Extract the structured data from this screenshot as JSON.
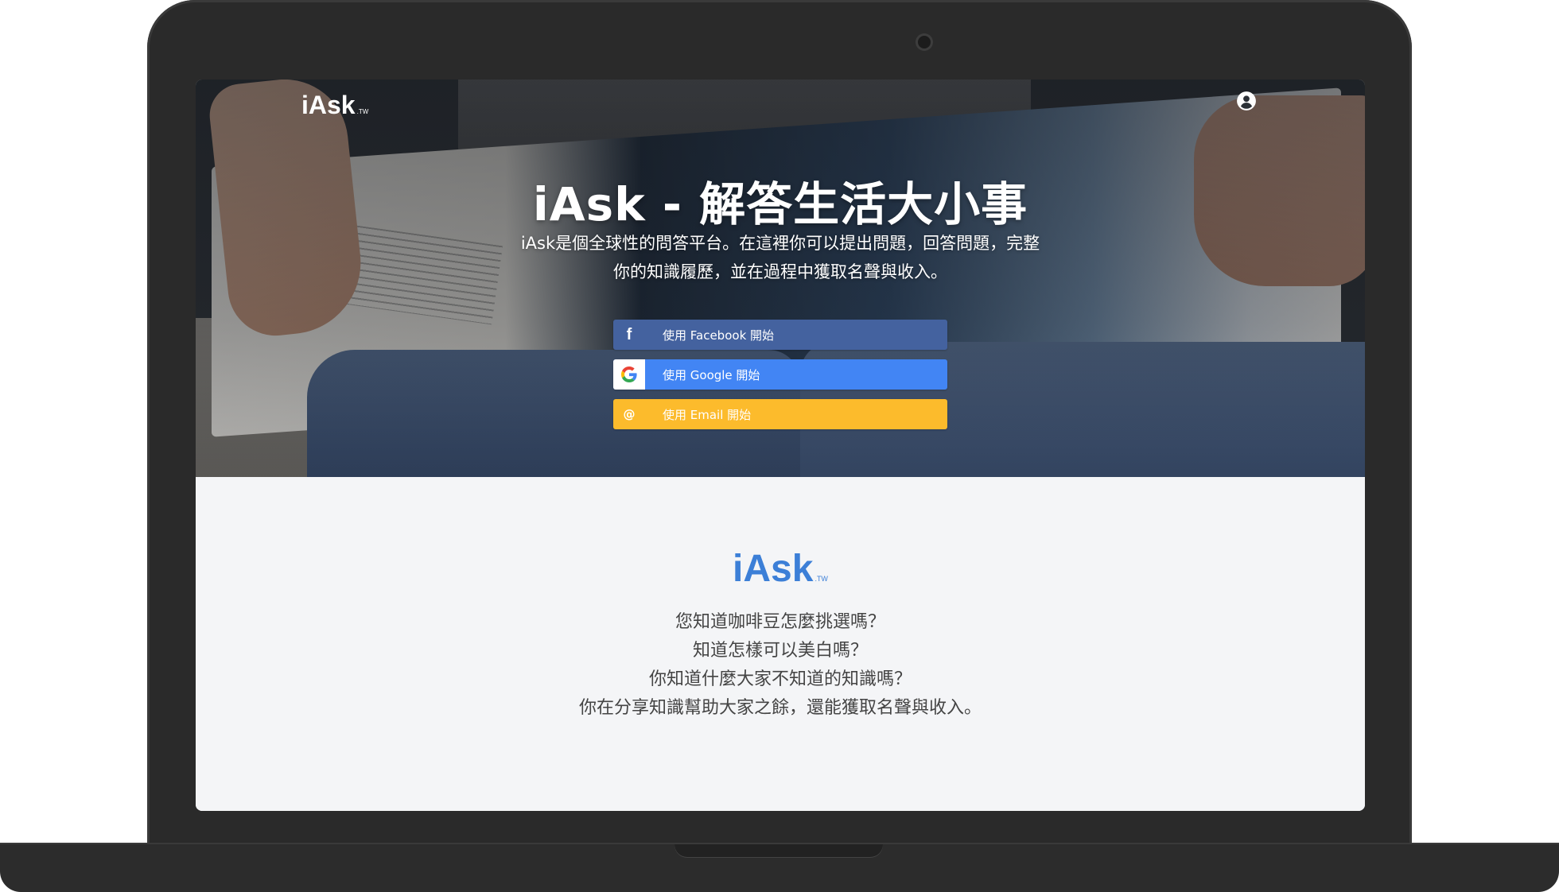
{
  "header": {
    "logo": "iAsk",
    "logo_suffix": ".TW",
    "user_icon": "user-circle-icon"
  },
  "hero": {
    "title": "iAsk - 解答生活大小事",
    "subtitle": "iAsk是個全球性的問答平台。在這裡你可以提出問題，回答問題，完整你的知識履歷，並在過程中獲取名聲與收入。"
  },
  "login": {
    "facebook_label": "使用 Facebook 開始",
    "google_label": "使用 Google 開始",
    "email_label": "使用 Email 開始",
    "email_icon_glyph": "@",
    "facebook_icon_glyph": "f",
    "icons": [
      "facebook-icon",
      "google-icon",
      "at-sign-icon"
    ],
    "colors": {
      "facebook": "#44629f",
      "google": "#4285f4",
      "email": "#fcbb2c"
    }
  },
  "intro": {
    "logo": "iAsk",
    "logo_suffix": ".TW",
    "lines": [
      "您知道咖啡豆怎麼挑選嗎？",
      "知道怎樣可以美白嗎？",
      "你知道什麼大家不知道的知識嗎？",
      "你在分享知識幫助大家之餘，還能獲取名聲與收入。"
    ]
  },
  "colors": {
    "brand_blue": "#3c7fd7",
    "page_bg": "#f4f5f7",
    "device": "#2a2a2a"
  }
}
